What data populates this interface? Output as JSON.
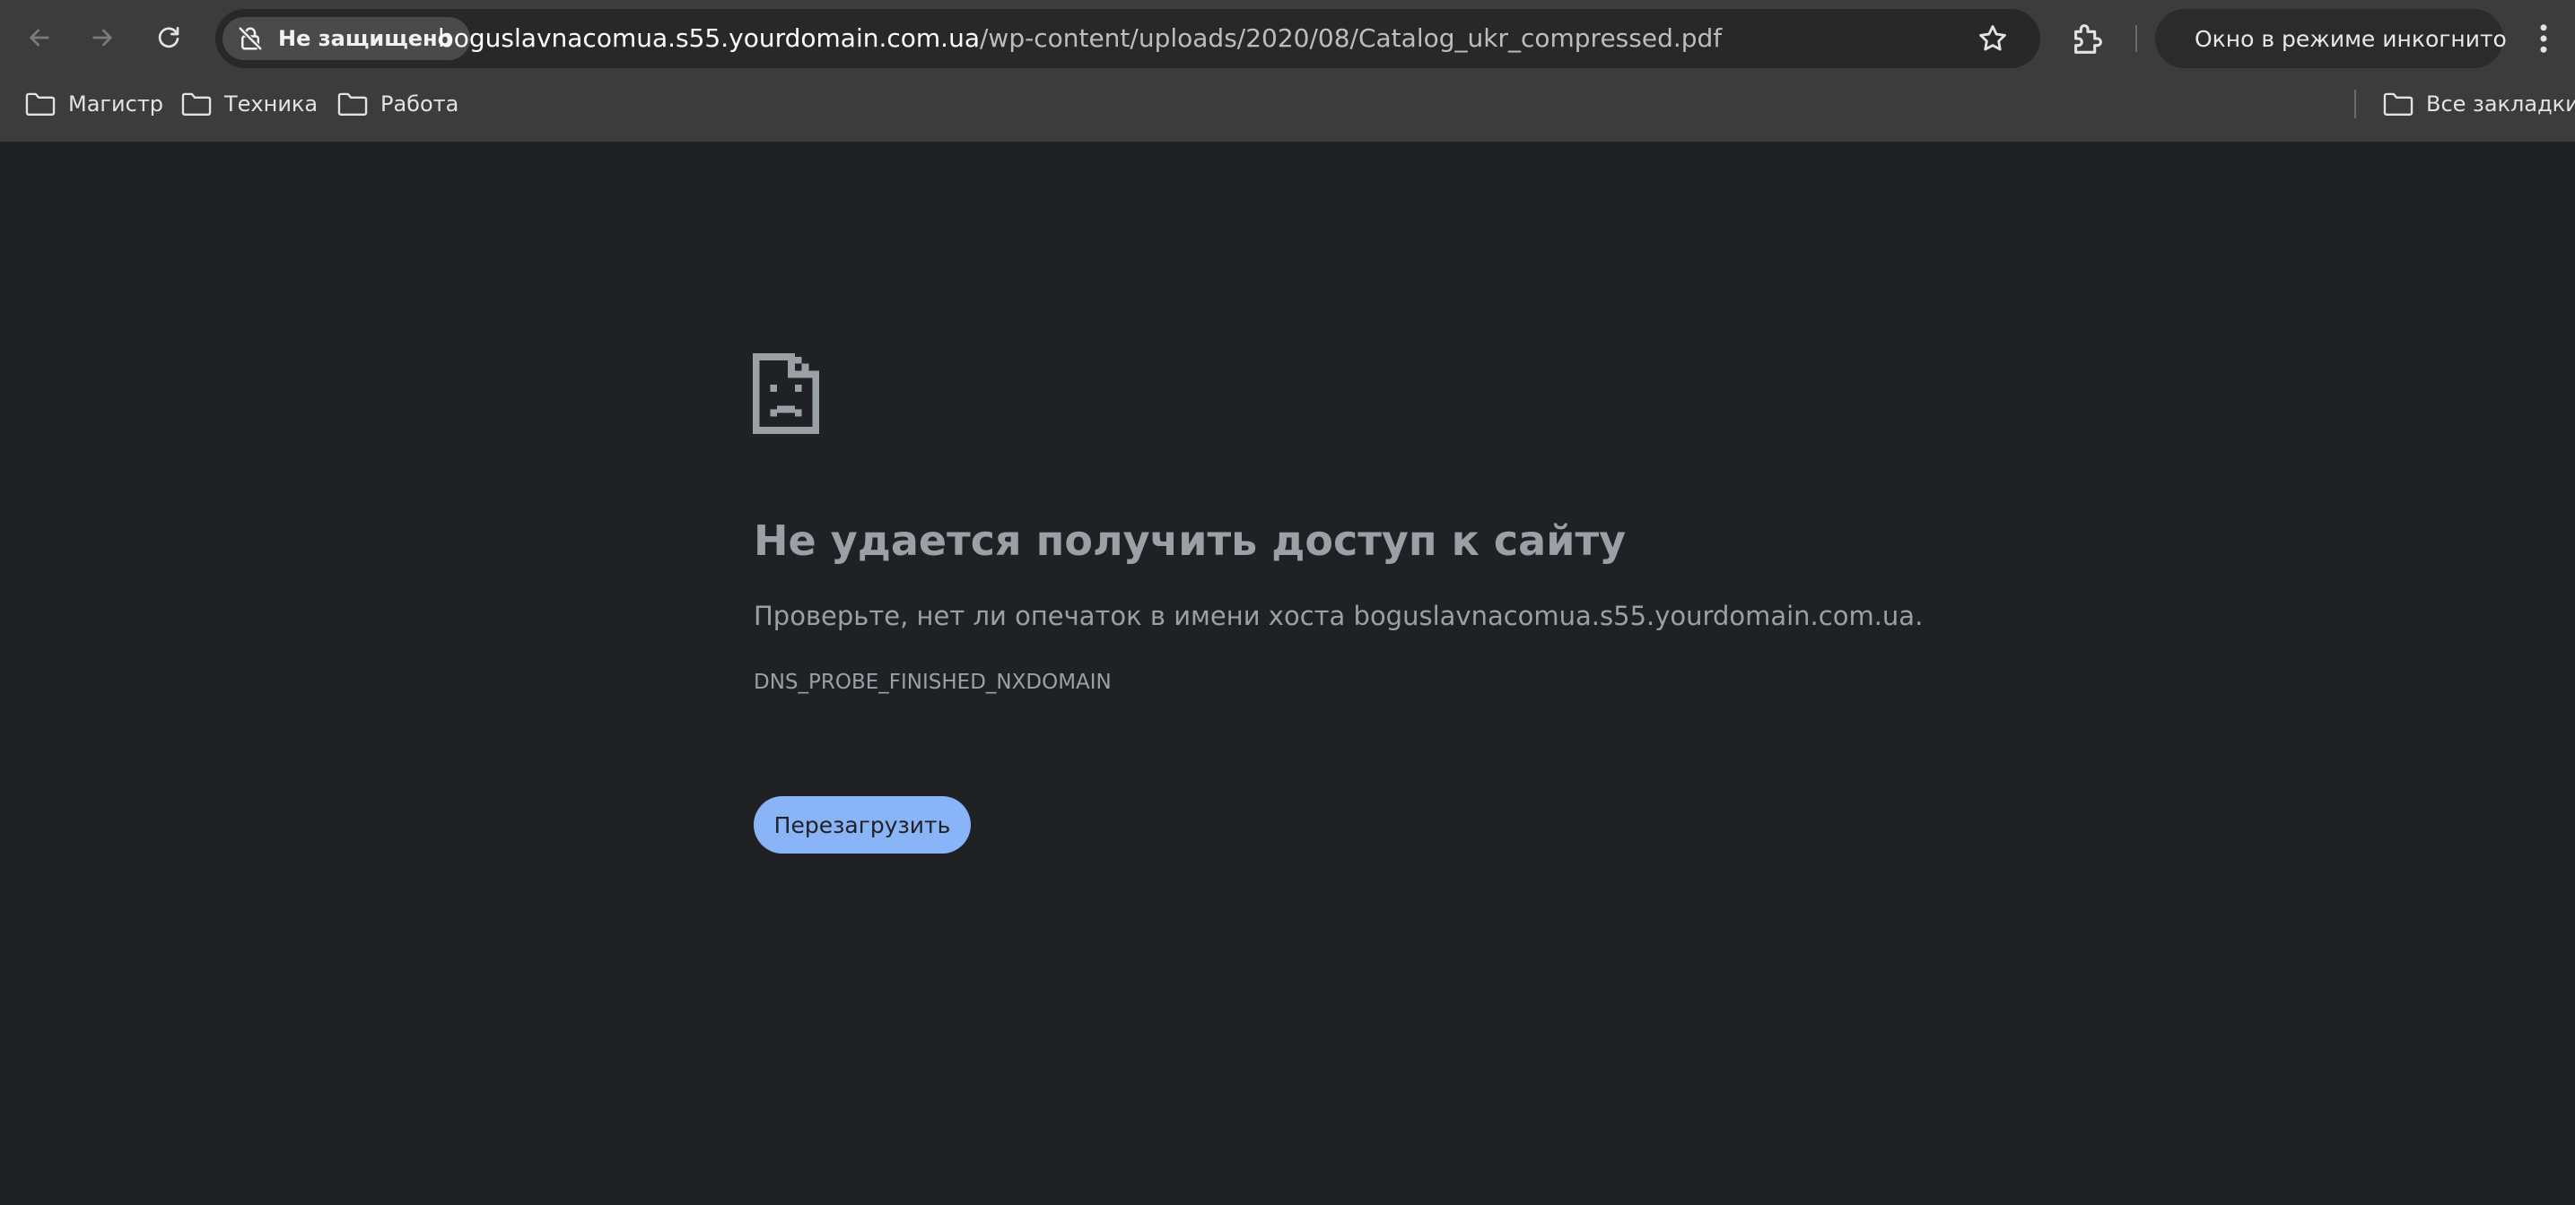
{
  "browser": {
    "nav": {
      "back_icon": "arrow-left-icon",
      "forward_icon": "arrow-right-icon",
      "reload_icon": "reload-icon"
    },
    "omnibox": {
      "security_label": "Не защищено",
      "security_icon": "not-secure-icon",
      "url_host": "boguslavnacomua.s55.yourdomain.com.ua",
      "url_path": "/wp-content/uploads/2020/08/Catalog_ukr_compressed.pdf",
      "bookmark_star_icon": "star-icon"
    },
    "extensions_icon": "puzzle-icon",
    "incognito": {
      "label": "Окно в режиме инкогнито",
      "icon": "incognito-icon"
    },
    "menu_icon": "kebab-menu-icon"
  },
  "bookmarks": {
    "items": [
      {
        "label": "Магистр"
      },
      {
        "label": "Техника"
      },
      {
        "label": "Работа"
      }
    ],
    "all_bookmarks_label": "Все закладки"
  },
  "error_page": {
    "icon": "sad-page-icon",
    "title": "Не удается получить доступ к сайту",
    "description": "Проверьте, нет ли опечаток в имени хоста boguslavnacomua.s55.yourdomain.com.ua.",
    "error_code": "DNS_PROBE_FINISHED_NXDOMAIN",
    "reload_button": "Перезагрузить"
  },
  "colors": {
    "toolbar_bg": "#3c3c3c",
    "page_bg": "#202124",
    "text_muted": "#9aa0a6",
    "accent_button": "#8ab4f8"
  }
}
